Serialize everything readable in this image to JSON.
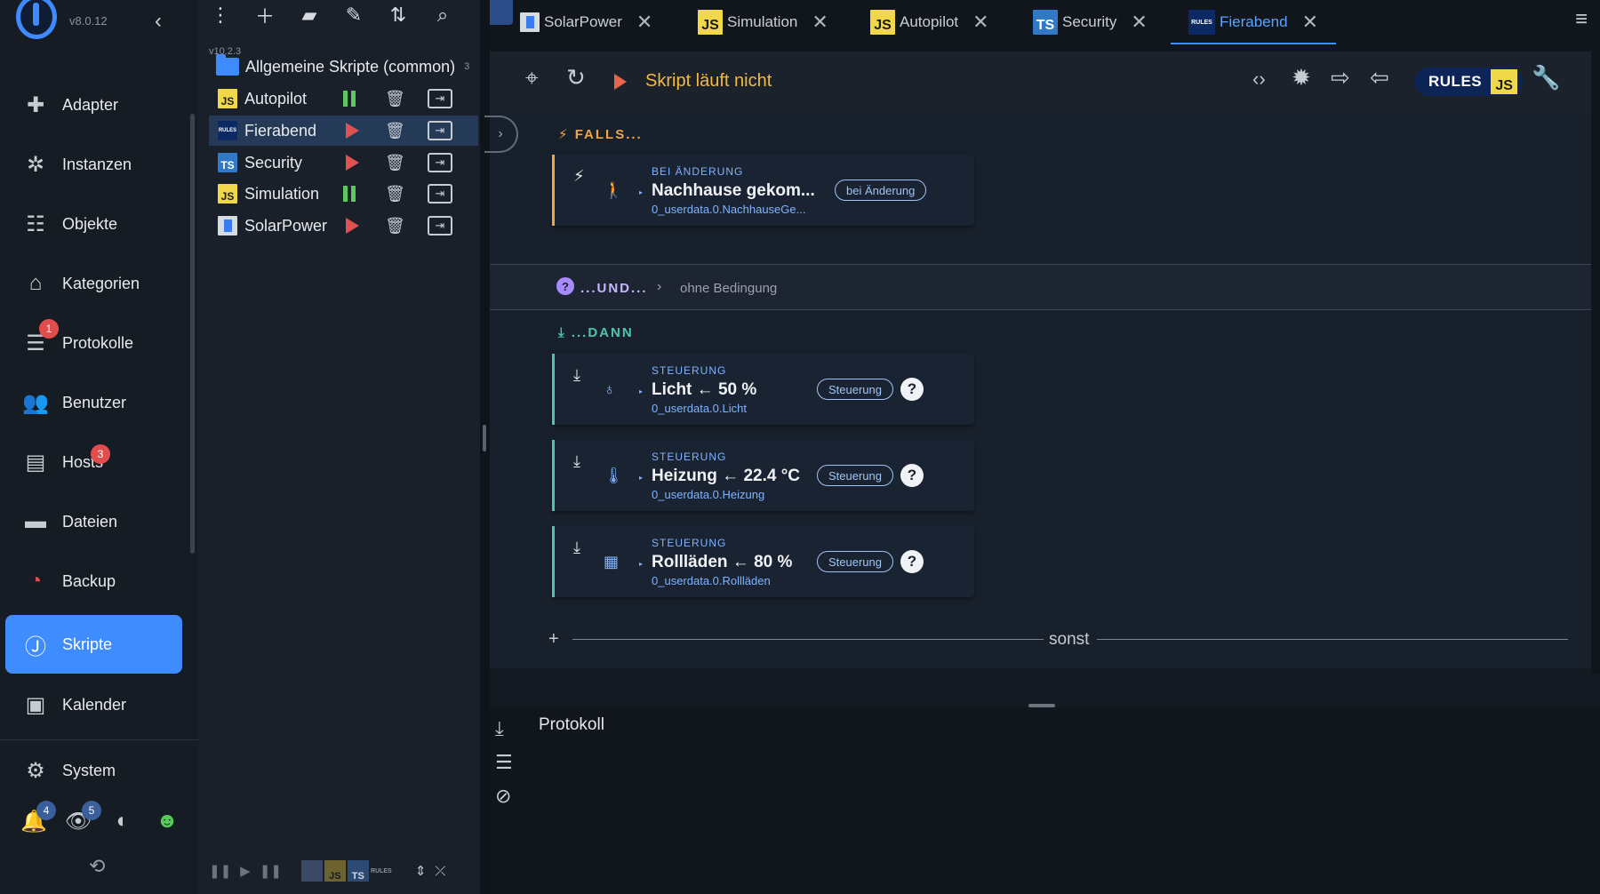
{
  "app": {
    "version": "v8.0.12",
    "collapse_icon": "chevron-left-icon"
  },
  "nav": {
    "items": [
      {
        "label": "Adapter",
        "icon": "puzzle-icon"
      },
      {
        "label": "Instanzen",
        "icon": "puzzle-gear-icon"
      },
      {
        "label": "Objekte",
        "icon": "tree-icon"
      },
      {
        "label": "Kategorien",
        "icon": "home-icon"
      },
      {
        "label": "Protokolle",
        "icon": "log-icon",
        "badge": "1"
      },
      {
        "label": "Benutzer",
        "icon": "users-icon"
      },
      {
        "label": "Hosts",
        "icon": "server-icon",
        "badge": "3"
      },
      {
        "label": "Dateien",
        "icon": "folder-icon"
      },
      {
        "label": "Backup",
        "icon": "backup-icon"
      },
      {
        "label": "Skripte",
        "icon": "scripts-icon",
        "active": true
      },
      {
        "label": "Kalender",
        "icon": "calendar-icon"
      },
      {
        "label": "System",
        "icon": "gear-icon"
      }
    ],
    "bottom": {
      "bell_badge": "4",
      "eye_badge": "5"
    }
  },
  "tree": {
    "version": "v10.2.3",
    "folder": {
      "label": "Allgemeine Skripte (common)",
      "count": "3"
    },
    "scripts": [
      {
        "label": "Autopilot",
        "type": "js",
        "type_label": "JS",
        "state": "pause"
      },
      {
        "label": "Fierabend",
        "type": "rules",
        "type_label": "RULES",
        "state": "play",
        "selected": true
      },
      {
        "label": "Security",
        "type": "ts",
        "type_label": "TS",
        "state": "play"
      },
      {
        "label": "Simulation",
        "type": "js",
        "type_label": "JS",
        "state": "pause"
      },
      {
        "label": "SolarPower",
        "type": "blk",
        "type_label": "",
        "state": "play"
      }
    ]
  },
  "tabs": [
    {
      "label": "SolarPower",
      "type": "blk"
    },
    {
      "label": "Simulation",
      "type": "js",
      "type_label": "JS"
    },
    {
      "label": "Autopilot",
      "type": "js",
      "type_label": "JS"
    },
    {
      "label": "Security",
      "type": "ts",
      "type_label": "TS"
    },
    {
      "label": "Fierabend",
      "type": "rules",
      "type_label": "RULES",
      "active": true
    }
  ],
  "toolbar": {
    "status": "Skript läuft nicht",
    "rules_label": "RULES",
    "js_label": "JS"
  },
  "editor": {
    "falls_label": "FALLS...",
    "trigger": {
      "category": "BEI ÄNDERUNG",
      "title": "Nachhause gekom...",
      "path": "0_userdata.0.NachhauseGe...",
      "pill": "bei Änderung"
    },
    "und_label": "...UND...",
    "und_value": "ohne Bedingung",
    "dann_label": "...DANN",
    "actions": [
      {
        "category": "STEUERUNG",
        "title": "Licht ← 50 %",
        "path": "0_userdata.0.Licht",
        "pill": "Steuerung",
        "help": "?",
        "icon": "bulb-icon"
      },
      {
        "category": "STEUERUNG",
        "title": "Heizung ← 22.4 °C",
        "path": "0_userdata.0.Heizung",
        "pill": "Steuerung",
        "help": "?",
        "icon": "thermometer-icon"
      },
      {
        "category": "STEUERUNG",
        "title": "Rollläden ← 80 %",
        "path": "0_userdata.0.Rollläden",
        "pill": "Steuerung",
        "help": "?",
        "icon": "shutter-icon"
      }
    ],
    "sonst_label": "sonst",
    "add_label": "+"
  },
  "log": {
    "title": "Protokoll"
  },
  "colors": {
    "accent": "#3f8cff",
    "trigger_bar": "#f5a443",
    "action_bar": "#4fc3b0",
    "status": "#f5b940"
  }
}
